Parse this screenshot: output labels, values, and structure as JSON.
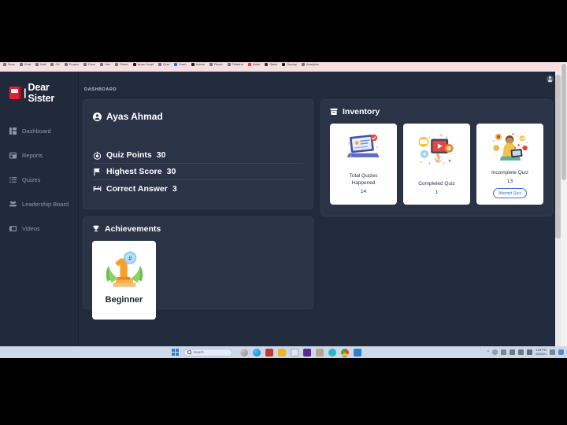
{
  "browser": {
    "bookmarks": [
      "Drop",
      "Chat",
      "Mail",
      "Git",
      "Project",
      "Docs",
      "Dev",
      "Sheet",
      "Apps Script",
      "Quiz",
      "Dash",
      "Admin",
      "React",
      "Tailwind",
      "Node",
      "Stack",
      "Deploy",
      "Analytics"
    ]
  },
  "app": {
    "logo": {
      "bar": "|",
      "name": "Dear Sister",
      "icon": "book-icon"
    },
    "sidebar": {
      "items": [
        {
          "label": "Dashboard",
          "icon": "dashboard-icon"
        },
        {
          "label": "Reports",
          "icon": "reports-icon"
        },
        {
          "label": "Quizes",
          "icon": "quizes-icon"
        },
        {
          "label": "Leadership Board",
          "icon": "leadership-board-icon"
        },
        {
          "label": "Videos",
          "icon": "videos-icon"
        }
      ]
    },
    "topbar": {
      "avatar_icon": "user-avatar-icon"
    },
    "breadcrumb": "DASHBOARD",
    "profile": {
      "name": "Ayas Ahmad",
      "name_icon": "person-circle-icon",
      "stats": [
        {
          "label": "Quiz Points",
          "value": "30",
          "icon": "target-icon"
        },
        {
          "label": "Highest Score",
          "value": "30",
          "icon": "flag-icon"
        },
        {
          "label": "Correct Answer",
          "value": "3",
          "icon": "bed-icon"
        }
      ]
    },
    "achievements": {
      "title": "Achievements",
      "title_icon": "trophy-icon",
      "badges": [
        {
          "label": "Beginner",
          "art": "first-place-trophy-art"
        }
      ]
    },
    "inventory": {
      "title": "Inventory",
      "title_icon": "archive-box-icon",
      "tiles": [
        {
          "label": "Total Quizes\nHappened",
          "label_line1": "Total Quizes",
          "label_line2": "Happened",
          "value": "14",
          "art": "laptop-quiz-art",
          "button": null
        },
        {
          "label_line1": "Completed Quiz",
          "label_line2": "",
          "value": "1",
          "art": "tablet-play-art",
          "button": null
        },
        {
          "label_line1": "Incomplete Quiz",
          "label_line2": "",
          "value": "13",
          "art": "person-laptop-art",
          "button": "Attempt Quiz"
        }
      ]
    },
    "colors": {
      "page_bg": "#222b3c",
      "card_bg": "#2b3447",
      "sidebar_bg": "#212a3b",
      "brand_red": "#e0232e",
      "accent_blue": "#3b6fd4",
      "muted_text": "#8e97a6"
    }
  },
  "taskbar": {
    "search_placeholder": "Search",
    "start_icon": "windows-start-icon",
    "apps": [
      "task-view-icon",
      "edge-icon",
      "camera-icon",
      "file-explorer-icon",
      "mail-icon",
      "vlc-icon",
      "store-icon",
      "settings-icon",
      "chrome-icon",
      "media-player-icon"
    ],
    "tray": {
      "chevron": "^",
      "icons": [
        "cloud-icon",
        "ime-icon",
        "wifi-icon",
        "volume-icon",
        "battery-icon"
      ],
      "time": "3:08 PM",
      "date": "4/5/2024",
      "notification_icon": "notifications-icon"
    }
  }
}
